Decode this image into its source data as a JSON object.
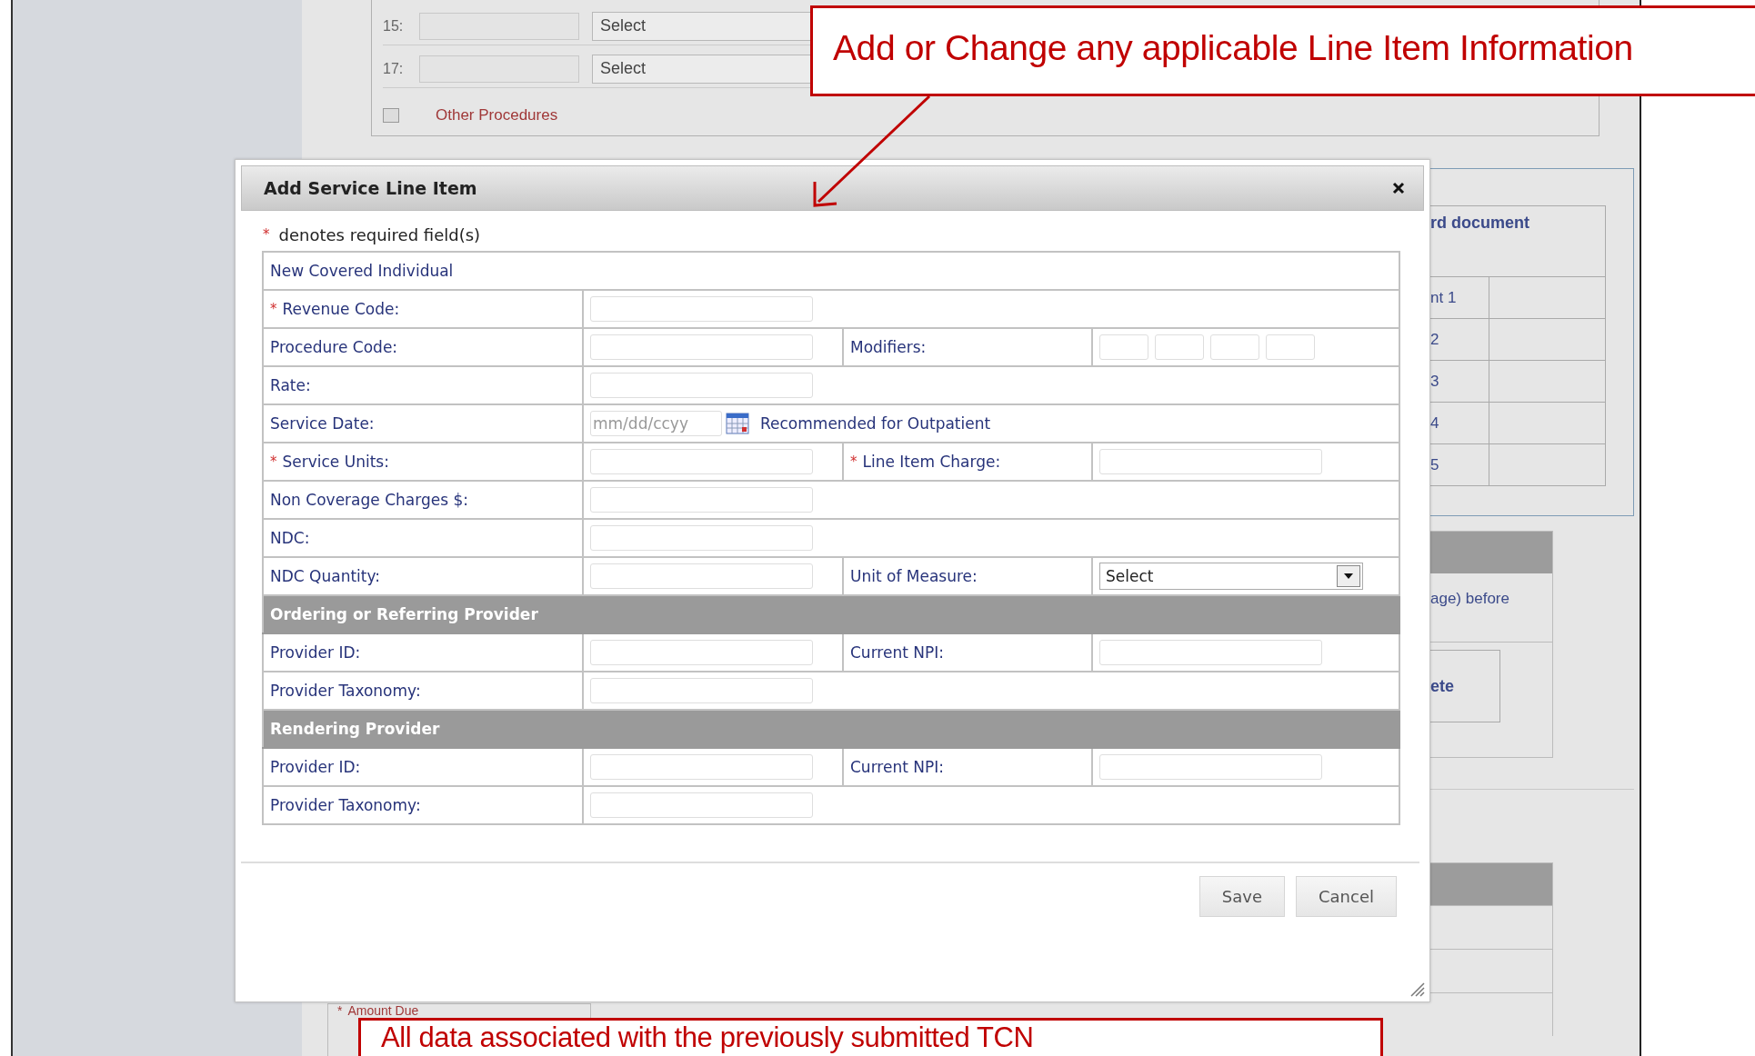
{
  "background": {
    "top_rows": [
      {
        "label": "15:",
        "select": "Select"
      },
      {
        "label": "17:",
        "select": "Select"
      }
    ],
    "other_procedures": {
      "label": "Other Procedures",
      "checked": false
    },
    "document_table": {
      "header": "rd document",
      "rows": [
        "nt 1",
        "2",
        "3",
        "4",
        "5"
      ]
    },
    "notice": "age) before",
    "side_button": "ete",
    "amount_due": {
      "mark": "*",
      "label": "Amount Due"
    }
  },
  "dialog": {
    "title": "Add Service Line Item",
    "required_note": {
      "mark": "*",
      "text": "denotes required field(s)"
    },
    "rows": [
      {
        "kind": "note",
        "label": "New Covered Individual"
      },
      {
        "kind": "field",
        "mark": "*",
        "label": "Revenue Code:"
      },
      {
        "kind": "pair_modifiers",
        "label": "Procedure Code:",
        "label2": "Modifiers:"
      },
      {
        "kind": "field",
        "label": "Rate:"
      },
      {
        "kind": "date",
        "label": "Service Date:",
        "placeholder": "mm/dd/ccyy",
        "hint": "Recommended for Outpatient"
      },
      {
        "kind": "pair_input",
        "mark": "*",
        "label": "Service Units:",
        "mark2": "*",
        "label2": "Line Item Charge:"
      },
      {
        "kind": "field",
        "label": "Non Coverage Charges $:"
      },
      {
        "kind": "field",
        "label": "NDC:"
      },
      {
        "kind": "pair_select",
        "label": "NDC Quantity:",
        "label2": "Unit of Measure:",
        "value2": "Select"
      },
      {
        "kind": "section",
        "label": "Ordering or Referring Provider"
      },
      {
        "kind": "pair_input",
        "label": "Provider ID:",
        "label2": "Current NPI:"
      },
      {
        "kind": "field",
        "label": "Provider Taxonomy:"
      },
      {
        "kind": "section",
        "label": "Rendering Provider"
      },
      {
        "kind": "pair_input",
        "label": "Provider ID:",
        "label2": "Current NPI:"
      },
      {
        "kind": "field",
        "label": "Provider Taxonomy:"
      }
    ],
    "buttons": [
      "Save",
      "Cancel"
    ]
  },
  "callouts": [
    {
      "text": "Add or Change any applicable Line Item Information"
    },
    {
      "text": "All data associated with the previously submitted TCN"
    }
  ]
}
